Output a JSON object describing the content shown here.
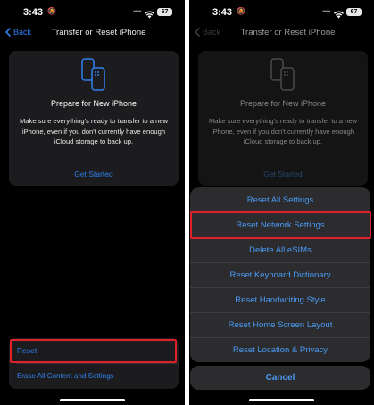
{
  "colors": {
    "accent": "#2f80ed",
    "highlight": "#e0202a",
    "card": "#1c1c1e",
    "sheet": "#2c2c2e"
  },
  "status_bar": {
    "time": "3:43",
    "battery": "67"
  },
  "left": {
    "nav": {
      "back_label": "Back",
      "title": "Transfer or Reset iPhone"
    },
    "prepare_card": {
      "title": "Prepare for New iPhone",
      "description": "Make sure everything's ready to transfer to a new iPhone, even if you don't currently have enough iCloud storage to back up.",
      "action": "Get Started"
    },
    "reset_list": {
      "reset": "Reset",
      "erase": "Erase All Content and Settings"
    }
  },
  "right": {
    "nav": {
      "back_label": "Back",
      "title": "Transfer or Reset iPhone"
    },
    "prepare_card": {
      "title": "Prepare for New iPhone",
      "description": "Make sure everything's ready to transfer to a new iPhone, even if you don't currently have enough iCloud storage to back up.",
      "action": "Get Started"
    },
    "action_sheet": {
      "items": [
        "Reset All Settings",
        "Reset Network Settings",
        "Delete All eSIMs",
        "Reset Keyboard Dictionary",
        "Reset Handwriting Style",
        "Reset Home Screen Layout",
        "Reset Location & Privacy"
      ],
      "cancel": "Cancel"
    }
  }
}
